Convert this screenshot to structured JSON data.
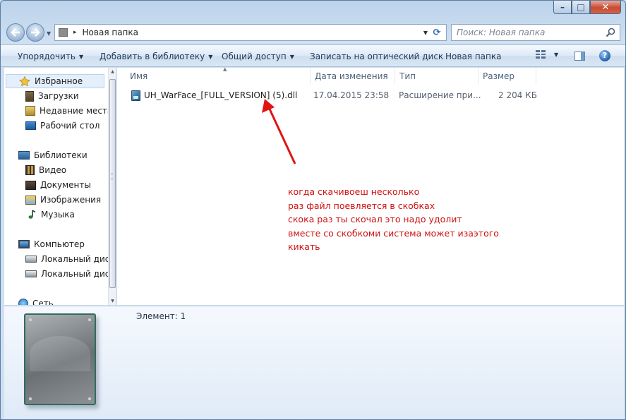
{
  "window": {
    "close_glyph": "✕",
    "min_glyph": "–",
    "max_glyph": "□"
  },
  "address": {
    "path": "Новая папка",
    "separator": "▸"
  },
  "search": {
    "placeholder": "Поиск: Новая папка"
  },
  "toolbar": {
    "organize": "Упорядочить",
    "add_library": "Добавить в библиотеку",
    "share": "Общий доступ",
    "burn": "Записать на оптический диск",
    "new_folder": "Новая папка",
    "help": "?"
  },
  "sidebar": {
    "favorites": "Избранное",
    "downloads": "Загрузки",
    "recent": "Недавние места",
    "desktop": "Рабочий стол",
    "libraries": "Библиотеки",
    "video": "Видео",
    "documents": "Документы",
    "images": "Изображения",
    "music": "Музыка",
    "computer": "Компьютер",
    "local_disk_1": "Локальный диск",
    "local_disk_2": "Локальный диск",
    "network": "Сеть"
  },
  "columns": {
    "name": "Имя",
    "date": "Дата изменения",
    "type": "Тип",
    "size": "Размер"
  },
  "files": [
    {
      "name": "UH_WarFace_[FULL_VERSION] (5).dll",
      "date": "17.04.2015 23:58",
      "type": "Расширение при...",
      "size": "2 204 КБ"
    }
  ],
  "annotation": {
    "line1": "когда скачивоеш несколько",
    "line2": "раз файл поевляется в скобках",
    "line3": "скока раз ты скочал это надо удолит",
    "line4": "вместе со скобкоми система может изаэтого",
    "line5": "кикать",
    "color": "#d01010"
  },
  "details": {
    "item_count": "Элемент: 1"
  }
}
